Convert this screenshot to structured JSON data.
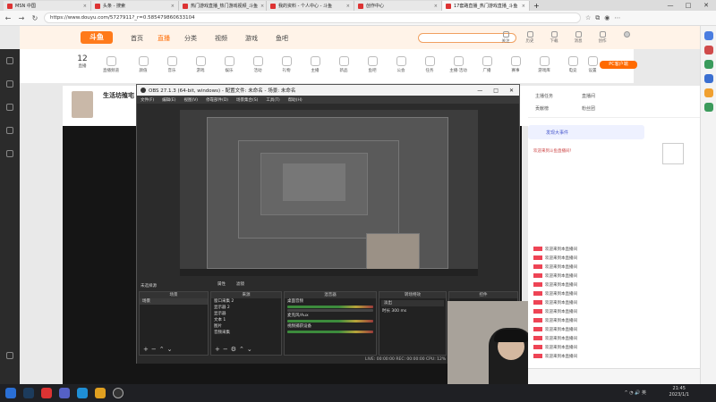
{
  "browser": {
    "tabs": [
      {
        "label": "MSN 中国"
      },
      {
        "label": "头条 - 搜索"
      },
      {
        "label": "热门游戏直播_热门游戏视频_斗鱼"
      },
      {
        "label": "我的资料 - 个人中心 - 斗鱼"
      },
      {
        "label": "创作中心"
      },
      {
        "label": "17套路直播_热门游戏直播_斗鱼"
      }
    ],
    "url": "https://www.douyu.com/5727911?_r=0.585479860633104"
  },
  "site": {
    "logo_text": "斗鱼",
    "nav": [
      "首页",
      "直播",
      "分类",
      "视频",
      "游戏",
      "鱼吧"
    ],
    "search_placeholder": "",
    "header_icons": [
      "关注",
      "历史",
      "下载",
      "消息",
      "创作",
      "开播"
    ],
    "categories": [
      {
        "label": "12",
        "sub": "直播"
      },
      {
        "label": "直播频道"
      },
      {
        "label": "颜值"
      },
      {
        "label": "音乐"
      },
      {
        "label": "游戏"
      },
      {
        "label": "娱乐"
      },
      {
        "label": "活动"
      },
      {
        "label": "礼物"
      },
      {
        "label": "主播"
      },
      {
        "label": "新品"
      },
      {
        "label": "鱼吧"
      },
      {
        "label": "公会"
      },
      {
        "label": "任务"
      },
      {
        "label": "主播·活动"
      },
      {
        "label": "广播"
      },
      {
        "label": "赛事"
      },
      {
        "label": "游戏库"
      },
      {
        "label": "电竞"
      },
      {
        "label": "设置"
      }
    ],
    "pc_button": "PC客户端",
    "streamer_name": "生活坊殖宅"
  },
  "obs": {
    "title": "OBS 27.1.3 (64-bit, windows) - 配置文件: 未命名 - 场景: 未命名",
    "menu": [
      "文件(F)",
      "编辑(E)",
      "视图(V)",
      "停靠部件(D)",
      "场景集合(S)",
      "工具(T)",
      "帮助(H)"
    ],
    "scene_label": "未选择源",
    "filter_buttons": [
      "属性",
      "滤镜"
    ],
    "docks": [
      {
        "title": "场景",
        "rows": [
          "场景"
        ]
      },
      {
        "title": "来源",
        "rows": [
          "窗口采集 2",
          "显示器 2",
          "显示器",
          "文本 1",
          "图片",
          "音频采集"
        ]
      },
      {
        "title": "混音器",
        "rows": [
          "桌面音频",
          "麦克风/Aux",
          "视频捕获设备"
        ]
      },
      {
        "title": "转场特效",
        "rows": [
          "淡出",
          "时长 300 ms"
        ]
      },
      {
        "title": "控件",
        "rows": []
      }
    ],
    "status": "LIVE: 00:00:00   REC: 00:00:00   CPU: 12%"
  },
  "chat": {
    "tabs": [
      "主播任务",
      "直播间",
      "贡献榜",
      "粉丝团"
    ],
    "banner": "发现大事件",
    "notice": "欢迎来到斗鱼直播间！",
    "messages": [
      "欢迎来到本直播间",
      "欢迎来到本直播间",
      "欢迎来到本直播间",
      "欢迎来到本直播间",
      "欢迎来到本直播间",
      "欢迎来到本直播间",
      "欢迎来到本直播间",
      "欢迎来到本直播间",
      "欢迎来到本直播间",
      "欢迎来到本直播间",
      "欢迎来到本直播间",
      "欢迎来到本直播间",
      "欢迎来到本直播间"
    ]
  },
  "taskbar": {
    "time": "21:45",
    "date": "2023/1/1"
  },
  "colors": {
    "accent": "#ff7a1a",
    "obs_bg": "#2b2b2b",
    "live_red": "#e02020"
  }
}
